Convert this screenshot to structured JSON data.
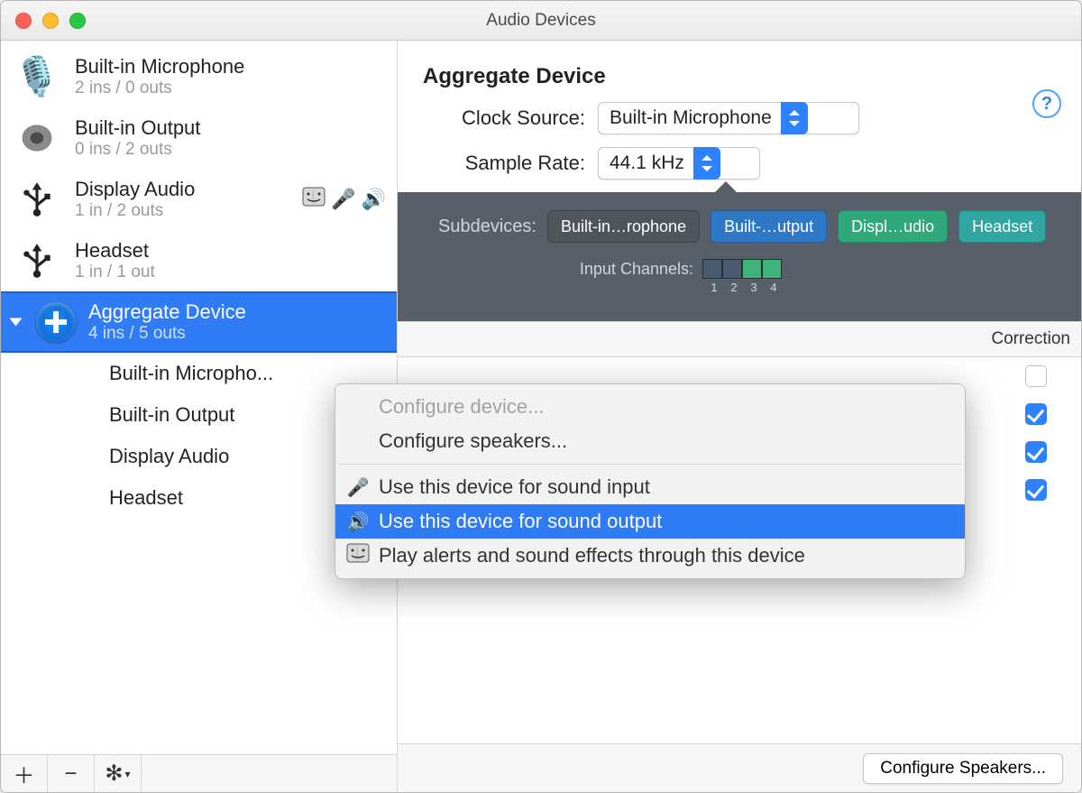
{
  "window": {
    "title": "Audio Devices"
  },
  "sidebar": {
    "devices": [
      {
        "name": "Built-in Microphone",
        "sub": "2 ins / 0 outs",
        "icon": "mic"
      },
      {
        "name": "Built-in Output",
        "sub": "0 ins / 2 outs",
        "icon": "speaker"
      },
      {
        "name": "Display Audio",
        "sub": "1 in / 2 outs",
        "icon": "usb",
        "status": true
      },
      {
        "name": "Headset",
        "sub": "1 in / 1 out",
        "icon": "usb"
      },
      {
        "name": "Aggregate Device",
        "sub": "4 ins / 5 outs",
        "icon": "plus",
        "selected": true
      }
    ],
    "children": [
      "Built-in Micropho...",
      "Built-in Output",
      "Display Audio",
      "Headset"
    ]
  },
  "main": {
    "title": "Aggregate Device",
    "clockSourceLabel": "Clock Source:",
    "clockSource": "Built-in Microphone",
    "sampleRateLabel": "Sample Rate:",
    "sampleRate": "44.1 kHz",
    "subdevicesLabel": "Subdevices:",
    "subdevices": [
      {
        "label": "Built-in…rophone",
        "style": "gray"
      },
      {
        "label": "Built-…utput",
        "style": "blue"
      },
      {
        "label": "Displ…udio",
        "style": "green"
      },
      {
        "label": "Headset",
        "style": "teal"
      }
    ],
    "inputChannelsLabel": "Input Channels:",
    "inputChannelNums": [
      "1",
      "2",
      "3",
      "4"
    ],
    "inputChannelColors": [
      "navy",
      "navy",
      "green",
      "green"
    ],
    "table": {
      "correctionHeader": "Correction",
      "rows": [
        {
          "checked": false
        },
        {
          "checked": true
        },
        {
          "checked": true
        },
        {
          "checked": true
        }
      ]
    },
    "configureSpeakers": "Configure Speakers..."
  },
  "context": {
    "items": [
      {
        "label": "Configure device...",
        "disabled": true
      },
      {
        "label": "Configure speakers..."
      },
      {
        "sep": true
      },
      {
        "label": "Use this device for sound input",
        "icon": "mic"
      },
      {
        "label": "Use this device for sound output",
        "icon": "speaker",
        "selected": true
      },
      {
        "label": "Play alerts and sound effects through this device",
        "icon": "finder"
      }
    ]
  }
}
